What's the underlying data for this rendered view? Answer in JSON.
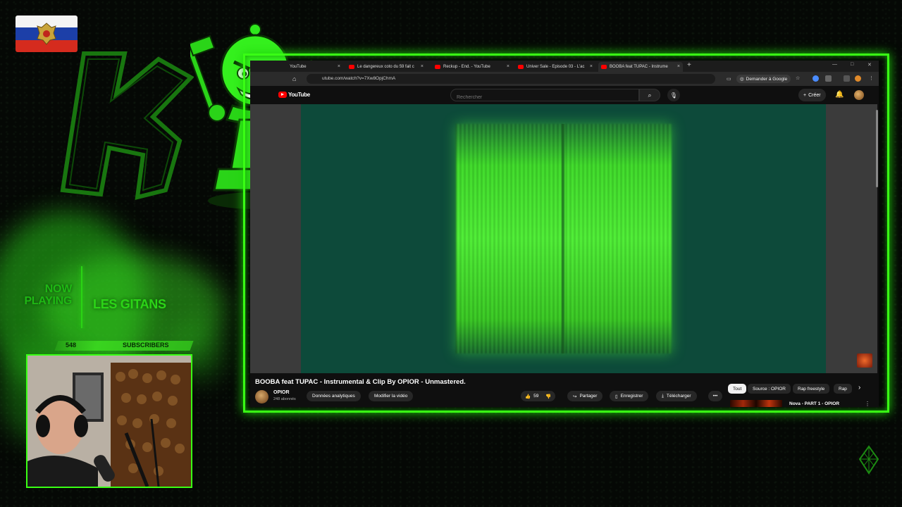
{
  "overlay": {
    "now_playing_label": "NOW PLAYING",
    "song_title": "LES GITANS",
    "subscriber_count": "548",
    "subscribers_label": "SUBSCRIBERS",
    "accent_color": "#39ff14"
  },
  "browser": {
    "tabs": [
      {
        "label": "YouTube",
        "icon": "youtube-icon"
      },
      {
        "label": "Le dangereux coto du 59 fait c",
        "icon": "youtube-icon"
      },
      {
        "label": "Reckup - End. - YouTube",
        "icon": "youtube-icon"
      },
      {
        "label": "Univer Sale - Episode 03 - L'ac",
        "icon": "youtube-icon"
      },
      {
        "label": "BOOBA feat TUPAC - Instrume",
        "icon": "youtube-icon",
        "active": true
      }
    ],
    "url": "utube.com/watch?v=7Xw8OpjChmA",
    "google_label": "Demander à Google"
  },
  "youtube": {
    "logo_text": "YouTube",
    "search_placeholder": "Rechercher",
    "create_label": "Créer",
    "video_title": "BOOBA feat TUPAC - Instrumental & Clip By OPIOR - Unmastered.",
    "channel_name": "OPIOR",
    "channel_subs": "248 abonnés",
    "analytics_label": "Données analytiques",
    "edit_label": "Modifier la vidéo",
    "like_count": "59",
    "share_label": "Partager",
    "save_label": "Enregistrer",
    "download_label": "Télécharger",
    "more_label": "•••",
    "chips": [
      "Tout",
      "Source : OPIOR",
      "Rap freestyle",
      "Rap"
    ],
    "recommended_title": "Nova - PART 1 - OPIOR"
  }
}
